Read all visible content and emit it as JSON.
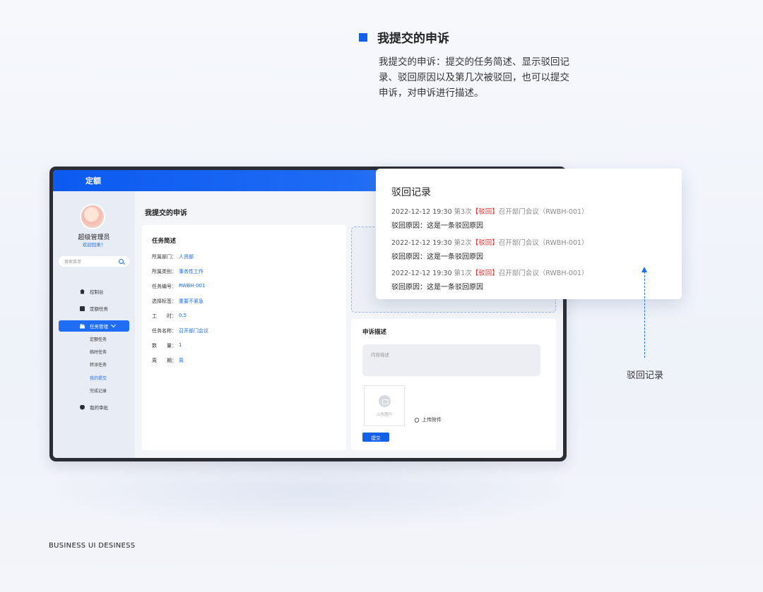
{
  "description": {
    "title": "我提交的申诉",
    "text": "我提交的申诉：提交的任务简述、显示驳回记录、驳回原因以及第几次被驳回，也可以提交申诉，对申诉进行描述。"
  },
  "app": {
    "header_title": "定额",
    "user": {
      "name": "超级管理员",
      "welcome": "欢迎回来！"
    },
    "search_placeholder": "搜索菜单",
    "nav": {
      "dashboard": "控制台",
      "quota_task": "定额任务",
      "task_manage": "任务管理",
      "sub": [
        "定额任务",
        "临时任务",
        "转派任务",
        "我的提交",
        "完成记录"
      ],
      "my_approval": "我的审批"
    },
    "page_title": "我提交的申诉",
    "summary": {
      "title": "任务简述",
      "rows": [
        {
          "k": "所属部门：",
          "v": "人资部"
        },
        {
          "k": "所属类别：",
          "v": "事务性工作"
        },
        {
          "k": "任务编号：",
          "v": "RWBH-001"
        },
        {
          "k": "选择标签：",
          "v": "重要不紧急"
        },
        {
          "k": "工　　时：",
          "v": "0.5"
        },
        {
          "k": "任务名称：",
          "v": "召开部门会议"
        },
        {
          "k": "数　　量：",
          "v": "1"
        },
        {
          "k": "周　　期：",
          "v": "周"
        }
      ]
    },
    "appeal": {
      "title": "申诉描述",
      "placeholder": "内容描述",
      "upload_image": "上传图片",
      "upload_attachment": "上传附件",
      "submit": "提交"
    }
  },
  "popup": {
    "title": "驳回记录",
    "records": [
      {
        "datetime": "2022-12-12  19:30",
        "count": "第3次",
        "tag": "【驳回】",
        "task": "召开部门会议（RWBH-001）",
        "reason": "驳回原因：这是一条驳回原因"
      },
      {
        "datetime": "2022-12-12  19:30",
        "count": "第2次",
        "tag": "【驳回】",
        "task": "召开部门会议（RWBH-001）",
        "reason": "驳回原因：这是一条驳回原因"
      },
      {
        "datetime": "2022-12-12  19:30",
        "count": "第1次",
        "tag": "【驳回】",
        "task": "召开部门会议（RWBH-001）",
        "reason": "驳回原因：这是一条驳回原因"
      }
    ]
  },
  "annotation": "驳回记录",
  "footer": "BUSINESS  UI  DESINESS",
  "colors": {
    "accent": "#1f6cf5",
    "reject": "#e32c2c"
  }
}
